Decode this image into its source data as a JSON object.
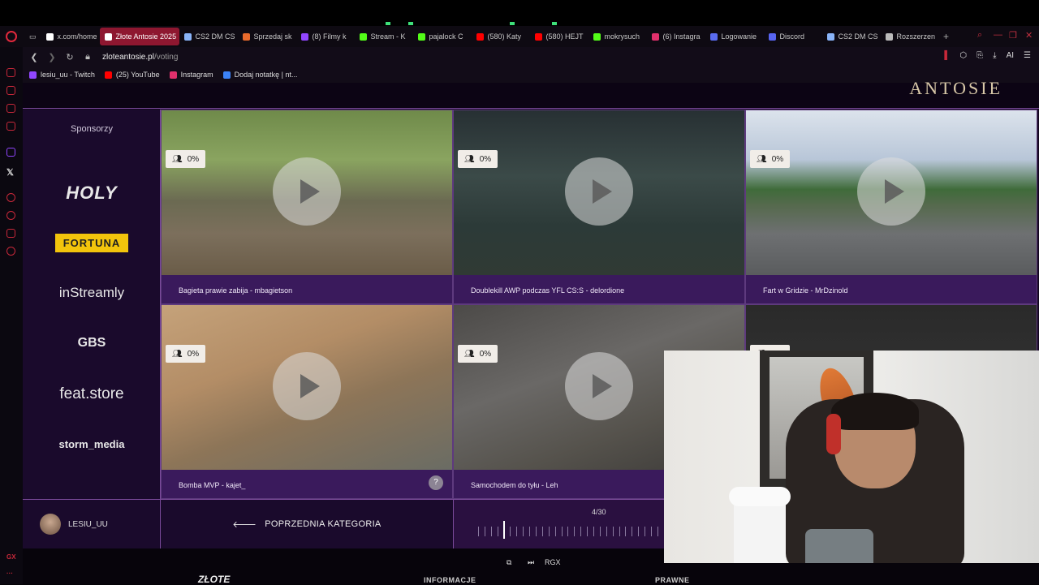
{
  "browser": {
    "tabs": [
      {
        "label": "x.com/home",
        "color": "#ffffff",
        "active": false
      },
      {
        "label": "Złote Antosie 2025",
        "color": "#ffffff",
        "active": true
      },
      {
        "label": "CS2 DM CS",
        "color": "#8ab4f8",
        "active": false
      },
      {
        "label": "Sprzedaj sk",
        "color": "#e86a2c",
        "active": false
      },
      {
        "label": "(8) Filmy k",
        "color": "#9146ff",
        "active": false
      },
      {
        "label": "Stream - K",
        "color": "#53fc18",
        "active": false
      },
      {
        "label": "pajalock C",
        "color": "#53fc18",
        "active": false
      },
      {
        "label": "(580) Katy",
        "color": "#ff0000",
        "active": false
      },
      {
        "label": "(580) HEJT",
        "color": "#ff0000",
        "active": false
      },
      {
        "label": "mokrysuch",
        "color": "#53fc18",
        "active": false
      },
      {
        "label": "(6) Instagra",
        "color": "#e1306c",
        "active": false
      },
      {
        "label": "Logowanie",
        "color": "#5a6cf0",
        "active": false
      },
      {
        "label": "Discord",
        "color": "#5865f2",
        "active": false
      },
      {
        "label": "CS2 DM CS",
        "color": "#8ab4f8",
        "active": false
      },
      {
        "label": "Rozszerzen",
        "color": "#bbbbbb",
        "active": false
      }
    ],
    "url_host": "zloteantosie.pl",
    "url_path": "/voting",
    "ai_label": "AI",
    "bookmarks": [
      {
        "label": "lesiu_uu - Twitch",
        "color": "#9146ff"
      },
      {
        "label": "(25) YouTube",
        "color": "#ff0000"
      },
      {
        "label": "Instagram",
        "color": "#e1306c"
      },
      {
        "label": "Dodaj notatkę | nt...",
        "color": "#3b82f6"
      }
    ],
    "sidebar_bottom": "GX"
  },
  "page": {
    "brand_partial": "ANTOSIE",
    "sponsors": {
      "title": "Sponsorzy",
      "logos": [
        "HOLY",
        "FORTUNA",
        "inStreamly",
        "GBS",
        "feat.store",
        "storm_media"
      ]
    },
    "clips": [
      {
        "percent": "0%",
        "title": "Bagieta prawie zabija - mbagietson"
      },
      {
        "percent": "0%",
        "title": "Doublekill AWP podczas YFL CS:S - delordione"
      },
      {
        "percent": "0%",
        "title": "Fart w Gridzie - MrDzinold"
      },
      {
        "percent": "0%",
        "title": "Bomba MVP - kajet_"
      },
      {
        "percent": "0%",
        "title": "Samochodem do tyłu - Leh"
      },
      {
        "percent": "0%",
        "title": ""
      }
    ],
    "help_label": "?",
    "user_name": "LESIU_UU",
    "prev_category": "POPRZEDNIA KATEGORIA",
    "counter": "4/30",
    "progress_fraction": 0.133,
    "footer": {
      "logo": "ZŁOTE",
      "col1": "INFORMACJE",
      "col2": "PRAWNE",
      "ctrl_label": "RGX"
    }
  },
  "colors": {
    "accent": "#7a4a9a",
    "caption_bg": "#3a1a5c",
    "fortuna": "#f2c40c",
    "opera_red": "#e0283c"
  }
}
